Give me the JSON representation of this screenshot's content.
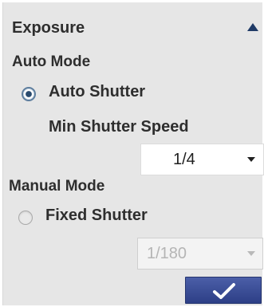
{
  "panel": {
    "title": "Exposure",
    "collapse_icon": "triangle-up-icon"
  },
  "auto_mode": {
    "section_label": "Auto Mode",
    "option_label": "Auto Shutter",
    "selected": true,
    "min_shutter_label": "Min Shutter Speed",
    "min_shutter_value": "1/4"
  },
  "manual_mode": {
    "section_label": "Manual Mode",
    "option_label": "Fixed Shutter",
    "selected": false,
    "fixed_shutter_value": "1/180",
    "enabled": false
  },
  "confirm_button": {
    "icon": "checkmark-icon",
    "color": "#34468f"
  },
  "colors": {
    "panel_bg": "#e6e6e6",
    "text": "#2e2e2e",
    "accent": "#2a4b6e"
  }
}
